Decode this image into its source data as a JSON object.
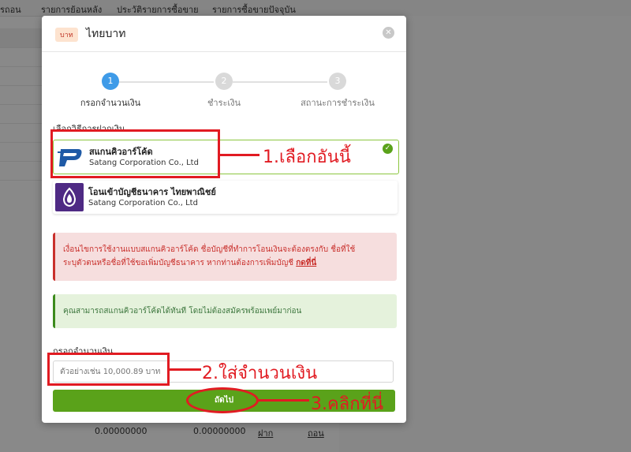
{
  "background": {
    "nav_items": [
      "รถอน",
      "รายการย้อนหลัง",
      "ประวัติรายการซื้อขาย",
      "รายการซื้อขายปัจจุบัน"
    ],
    "bottom_row": {
      "value1": "0.00000000",
      "value2": "0.00000000",
      "link1": "ฝาก",
      "link2": "ถอน"
    }
  },
  "modal": {
    "currency_badge": "บาท",
    "title": "ไทยบาท",
    "steps": [
      {
        "number": "1",
        "label": "กรอกจำนวนเงิน",
        "active": true
      },
      {
        "number": "2",
        "label": "ชำระเงิน",
        "active": false
      },
      {
        "number": "3",
        "label": "สถานะการชำระเงิน",
        "active": false
      }
    ],
    "method_section_label": "เลือกวิธีการฝากเงิน",
    "methods": [
      {
        "title": "สแกนคิวอาร์โค้ด",
        "subtitle": "Satang Corporation Co., Ltd",
        "selected": true,
        "logo": "promptpay-logo"
      },
      {
        "title": "โอนเข้าบัญชีธนาคาร ไทยพาณิชย์",
        "subtitle": "Satang Corporation Co., Ltd",
        "selected": false,
        "logo": "scb-logo"
      }
    ],
    "warning": {
      "line1": "เงื่อนไขการใช้งานแบบสแกนคิวอาร์โค้ด ชื่อบัญชีที่ทำการโอนเงินจะต้องตรงกับ ชื่อที่ใช้",
      "line2": "ระบุตัวตนหรือชื่อที่ใช้ขอเพิ่มบัญชีธนาคาร หากท่านต้องการเพิ่มบัญชี",
      "link": "กดที่นี่"
    },
    "info": "คุณสามารถสแกนคิวอาร์โค้ดได้ทันที โดยไม่ต้องสมัครพร้อมเพย์มาก่อน",
    "amount_label": "กรอกจำนวนเงิน",
    "amount_placeholder": "ตัวอย่างเช่น 10,000.89 บาท",
    "next_label": "ถัดไป"
  },
  "annotations": {
    "step1": "1.เลือกอันนี้",
    "step2": "2.ใส่จำนวนเงิน",
    "step3": "3.คลิกที่นี่"
  },
  "colors": {
    "accent_green": "#5aa21a",
    "step_active": "#3f9be8",
    "step_inactive": "#d9d9d9",
    "annotation_red": "#e11b22",
    "warning_bg": "#f6dede",
    "info_bg": "#e5f2dc"
  }
}
